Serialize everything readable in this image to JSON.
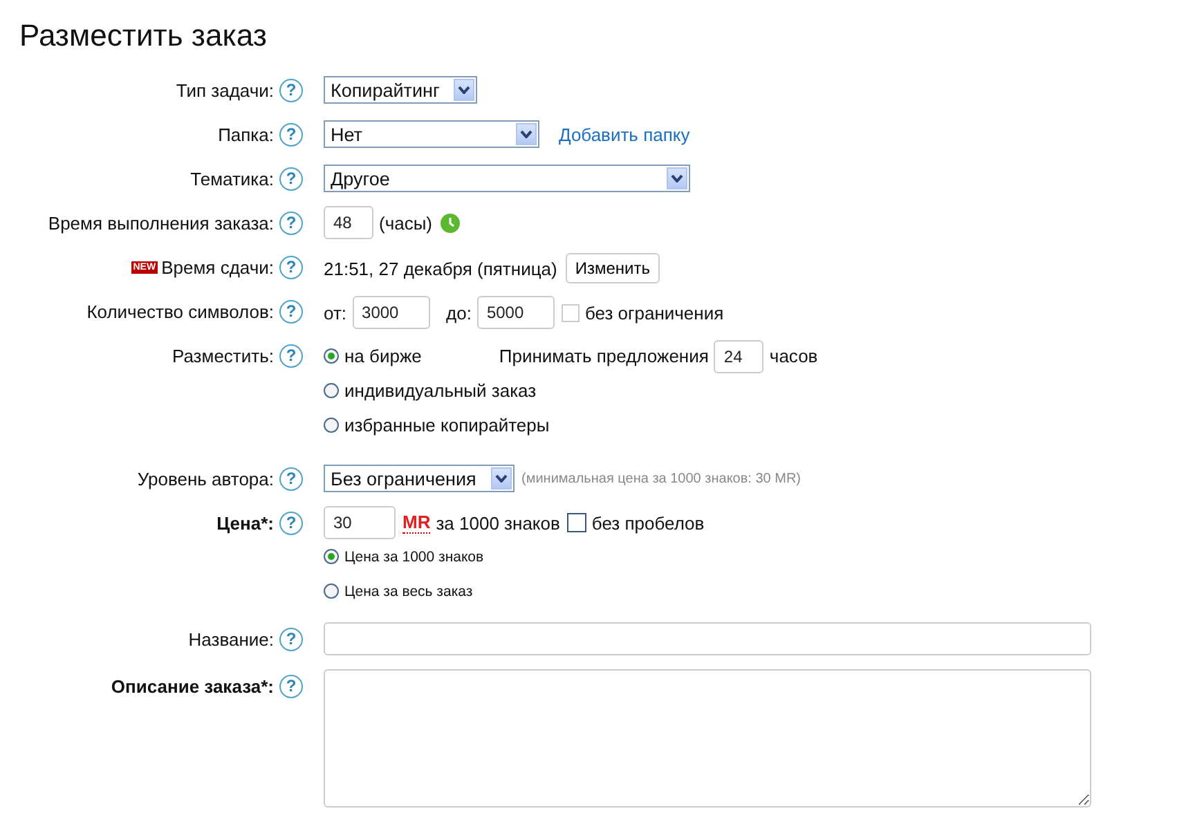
{
  "title": "Разместить заказ",
  "rows": [
    {
      "kind": "select",
      "label": "Тип задачи:",
      "help": "?",
      "value": "Копирайтинг"
    },
    {
      "kind": "select",
      "label": "Папка:",
      "help": "?",
      "value": "Нет",
      "link": "Добавить папку"
    },
    {
      "kind": "select",
      "label": "Тематика:",
      "help": "?",
      "value": "Другое"
    },
    {
      "kind": "time",
      "label": "Время выполнения заказа:",
      "help": "?",
      "value": "48",
      "unit": "(часы)"
    },
    {
      "kind": "deadline",
      "badge": "NEW",
      "label": "Время сдачи:",
      "help": "?",
      "value": "21:51, 27 декабря (пятница)",
      "button": "Изменить"
    },
    {
      "kind": "range",
      "label": "Количество символов:",
      "help": "?",
      "from_label": "от:",
      "from": "3000",
      "to_label": "до:",
      "to": "5000",
      "checkbox": {
        "label": "без ограничения",
        "checked": false
      }
    },
    {
      "kind": "placement",
      "label": "Разместить:",
      "help": "?",
      "options": [
        {
          "label": "на бирже",
          "selected": true
        },
        {
          "label": "индивидуальный заказ",
          "selected": false
        },
        {
          "label": "избранные копирайтеры",
          "selected": false
        }
      ],
      "offers_label": "Принимать предложения",
      "offers_value": "24",
      "offers_unit": "часов"
    },
    {
      "kind": "level",
      "label": "Уровень автора:",
      "help": "?",
      "value": "Без ограничения",
      "note": "(минимальная цена за 1000 знаков: 30 MR)"
    },
    {
      "kind": "price",
      "label": "Цена*:",
      "bold": true,
      "help": "?",
      "value": "30",
      "currency": "MR",
      "unit": "за 1000 знаков",
      "checkbox": {
        "label": "без пробелов",
        "checked": false
      },
      "options": [
        {
          "label": "Цена за 1000 знаков",
          "selected": true
        },
        {
          "label": "Цена за весь заказ",
          "selected": false
        }
      ]
    },
    {
      "kind": "text",
      "label": "Название:",
      "help": "?"
    },
    {
      "kind": "textarea",
      "label": "Описание заказа*:",
      "bold": true,
      "help": "?"
    }
  ]
}
